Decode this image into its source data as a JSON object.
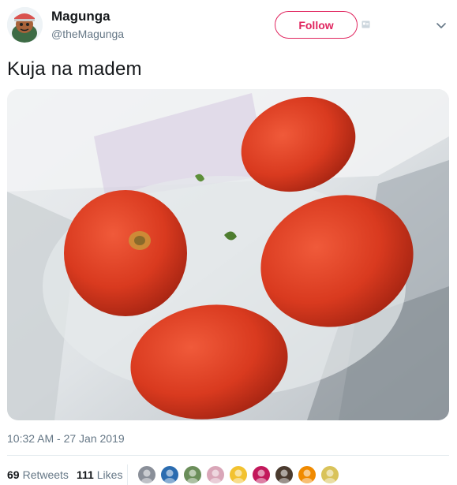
{
  "author": {
    "display_name": "Magunga",
    "handle": "@theMagunga",
    "avatar_icon": "cartoon-avatar-icon"
  },
  "actions": {
    "follow_label": "Follow",
    "follow_color": "#e0245e"
  },
  "tweet": {
    "text": "Kuja na madem",
    "timestamp": "10:32 AM - 27 Jan 2019"
  },
  "stats": {
    "retweets_count": "69",
    "retweets_label": "Retweets",
    "likes_count": "111",
    "likes_label": "Likes"
  },
  "likers": [
    {
      "icon": "liker-avatar-icon",
      "color": "#8a8f99"
    },
    {
      "icon": "liker-avatar-icon",
      "color": "#2b6cb0"
    },
    {
      "icon": "liker-avatar-icon",
      "color": "#6b8e5a"
    },
    {
      "icon": "liker-avatar-icon",
      "color": "#d9a6b8"
    },
    {
      "icon": "liker-avatar-icon",
      "color": "#f2c230"
    },
    {
      "icon": "liker-avatar-icon",
      "color": "#c2185b"
    },
    {
      "icon": "liker-avatar-icon",
      "color": "#4a3a2e"
    },
    {
      "icon": "liker-avatar-icon",
      "color": "#f08a00"
    },
    {
      "icon": "liker-avatar-icon",
      "color": "#d9c35a"
    }
  ],
  "colors": {
    "text": "#14171a",
    "secondary": "#657786",
    "border": "#e6ecf0"
  }
}
